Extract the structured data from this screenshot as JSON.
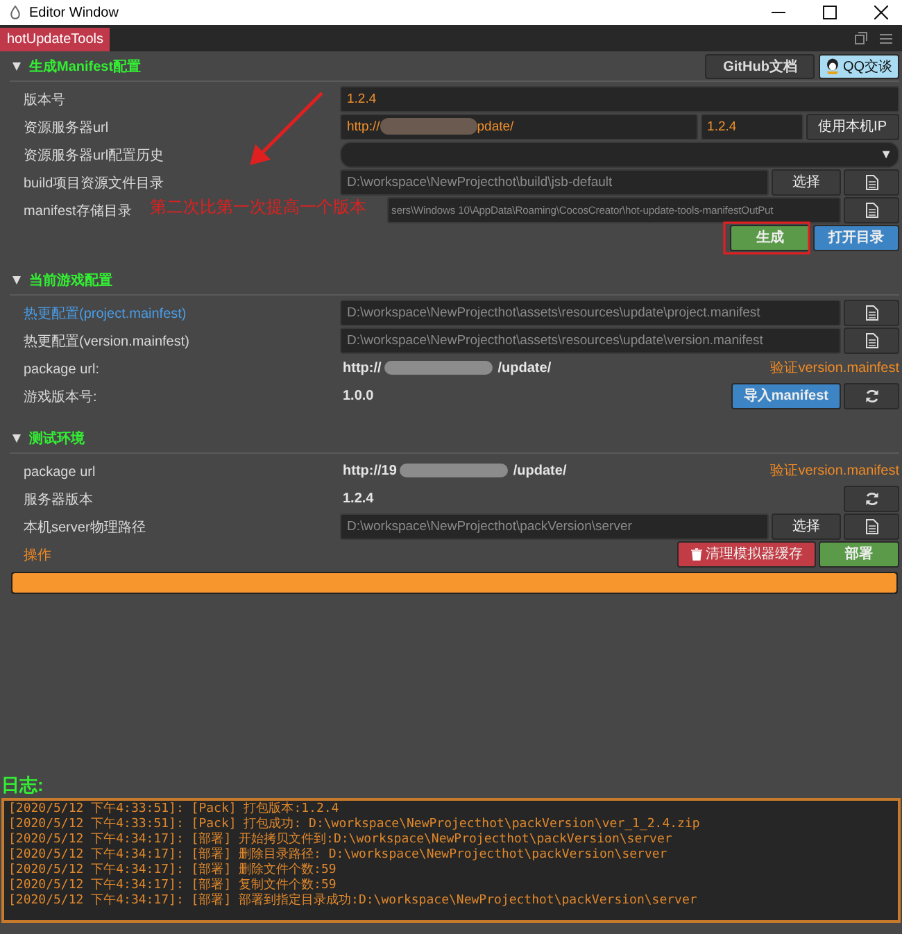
{
  "window": {
    "title": "Editor Window"
  },
  "tabs": [
    {
      "label": "hotUpdateTools",
      "selected": true
    }
  ],
  "sections": [
    {
      "title": "生成Manifest配置",
      "expanded": true,
      "header_buttons": [
        {
          "label": "GitHub文档",
          "kind": "docs"
        },
        {
          "label": "QQ交谈",
          "kind": "qq"
        }
      ],
      "rows": [
        {
          "label": "版本号",
          "controls": [
            {
              "kind": "version_input",
              "value": "1.2.4"
            }
          ]
        },
        {
          "label": "资源服务器url",
          "controls": [
            {
              "kind": "url_input",
              "prefix": "http://",
              "suffix": "pdate/"
            },
            {
              "kind": "small_input",
              "value": "1.2.4"
            },
            {
              "kind": "gray_button",
              "label": "使用本机IP"
            }
          ]
        },
        {
          "label": "资源服务器url配置历史",
          "controls": [
            {
              "kind": "select",
              "caret": "▼"
            }
          ]
        },
        {
          "label": "build项目资源文件目录",
          "controls": [
            {
              "kind": "path_input",
              "value": "D:\\workspace\\NewProjecthot\\build\\jsb-default"
            },
            {
              "kind": "gray_button",
              "label": "选择"
            },
            {
              "kind": "file_button"
            }
          ]
        },
        {
          "label": "manifest存储目录",
          "controls": [
            {
              "kind": "covered_path_input",
              "value": "sers\\Windows 10\\AppData\\Roaming\\CocosCreator\\hot-update-tools-manifestOutPut"
            },
            {
              "kind": "file_button"
            }
          ]
        },
        {
          "controls": [
            {
              "kind": "spacer"
            },
            {
              "kind": "green_button",
              "label": "生成"
            },
            {
              "kind": "blue_button",
              "label": "打开目录"
            }
          ]
        }
      ]
    },
    {
      "title": "当前游戏配置",
      "expanded": true,
      "rows": [
        {
          "label": "热更配置(project.mainfest)",
          "kind": "link",
          "controls": [
            {
              "kind": "path_input",
              "value": "D:\\workspace\\NewProjecthot\\assets\\resources\\update\\project.manifest"
            },
            {
              "kind": "file_button"
            }
          ]
        },
        {
          "label": "热更配置(version.mainfest)",
          "controls": [
            {
              "kind": "path_input",
              "value": "D:\\workspace\\NewProjecthot\\assets\\resources\\update\\version.manifest"
            },
            {
              "kind": "file_button"
            }
          ]
        },
        {
          "label": "package url:",
          "controls": [
            {
              "kind": "masked_text",
              "prefix": "http://",
              "suffix": "/update/"
            },
            {
              "kind": "link",
              "label": "验证version.mainfest"
            }
          ]
        },
        {
          "label": "游戏版本号:",
          "controls": [
            {
              "kind": "text",
              "value": "1.0.0"
            },
            {
              "kind": "blue_button",
              "label": "导入manifest"
            },
            {
              "kind": "refresh_button"
            }
          ]
        }
      ]
    },
    {
      "title": "测试环境",
      "expanded": true,
      "rows": [
        {
          "label": "package url",
          "controls": [
            {
              "kind": "masked_text",
              "prefix": "http://19",
              "suffix": "/update/"
            },
            {
              "kind": "link",
              "label": "验证version.manifest"
            }
          ]
        },
        {
          "label": "服务器版本",
          "controls": [
            {
              "kind": "text",
              "value": "1.2.4"
            },
            {
              "kind": "refresh_button"
            }
          ]
        },
        {
          "label": "本机server物理路径",
          "controls": [
            {
              "kind": "path_input",
              "value": "D:\\workspace\\NewProjecthot\\packVersion\\server"
            },
            {
              "kind": "gray_button",
              "label": "选择"
            },
            {
              "kind": "file_button"
            }
          ]
        },
        {
          "label": "操作",
          "kind": "warning",
          "controls": [
            {
              "kind": "spacer"
            },
            {
              "kind": "clear_button",
              "label": "清理模拟器缓存"
            },
            {
              "kind": "green_button",
              "label": "部署"
            }
          ]
        }
      ],
      "progress": {
        "level": 1
      }
    }
  ],
  "log": {
    "title": "日志:",
    "lines": [
      "[2020/5/12 下午4:33:51]: [Pack] 打包版本:1.2.4",
      "[2020/5/12 下午4:33:51]: [Pack] 打包成功: D:\\workspace\\NewProjecthot\\packVersion\\ver_1_2.4.zip",
      "[2020/5/12 下午4:34:17]: [部署] 开始拷贝文件到:D:\\workspace\\NewProjecthot\\packVersion\\server",
      "[2020/5/12 下午4:34:17]: [部署] 删除目录路径: D:\\workspace\\NewProjecthot\\packVersion\\server",
      "[2020/5/12 下午4:34:17]: [部署] 删除文件个数:59",
      "[2020/5/12 下午4:34:17]: [部署] 复制文件个数:59",
      "[2020/5/12 下午4:34:17]: [部署] 部署到指定目录成功:D:\\workspace\\NewProjecthot\\packVersion\\server"
    ]
  },
  "annotation": {
    "text": "第二次比第一次提高一个版本"
  }
}
